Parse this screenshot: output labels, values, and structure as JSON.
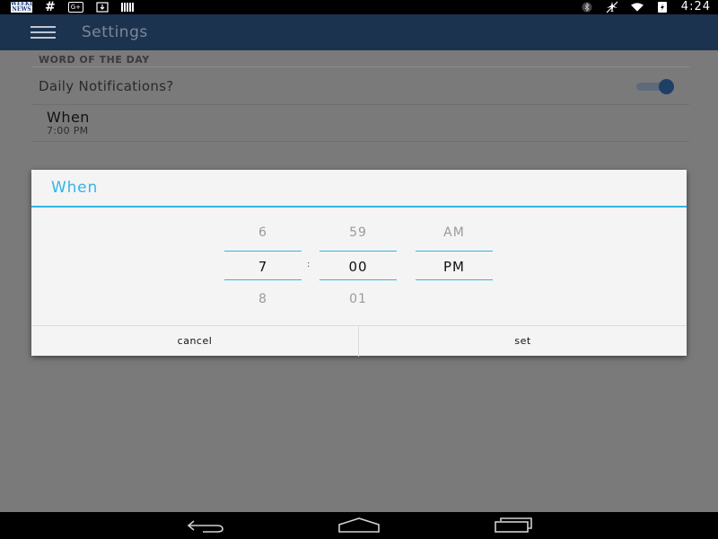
{
  "status_bar": {
    "app_icon_text": "WEEKLY NEWS",
    "hash": "#",
    "gplus": "G+",
    "time": "4:24",
    "icons": [
      "app-icon",
      "hash-icon",
      "google-plus-icon",
      "download-icon",
      "barcode-icon",
      "bluetooth-icon",
      "airplane-mode-icon",
      "wifi-icon",
      "battery-icon"
    ]
  },
  "app_bar": {
    "title": "Settings"
  },
  "settings": {
    "section_header": "WORD OF THE DAY",
    "notifications": {
      "label": "Daily Notifications?",
      "enabled": true
    },
    "when": {
      "title": "When",
      "summary": "7:00 PM"
    }
  },
  "dialog": {
    "title": "When",
    "hour": {
      "prev": "6",
      "current": "7",
      "next": "8"
    },
    "separator": ":",
    "minute": {
      "prev": "59",
      "current": "00",
      "next": "01"
    },
    "ampm": {
      "prev": "AM",
      "current": "PM",
      "next": ""
    },
    "cancel_label": "cancel",
    "set_label": "set"
  },
  "colors": {
    "accent": "#33b5e5",
    "app_bar": "#1c3350",
    "toggle_on": "#1e3f66",
    "dim_background": "#7a7a7a"
  }
}
